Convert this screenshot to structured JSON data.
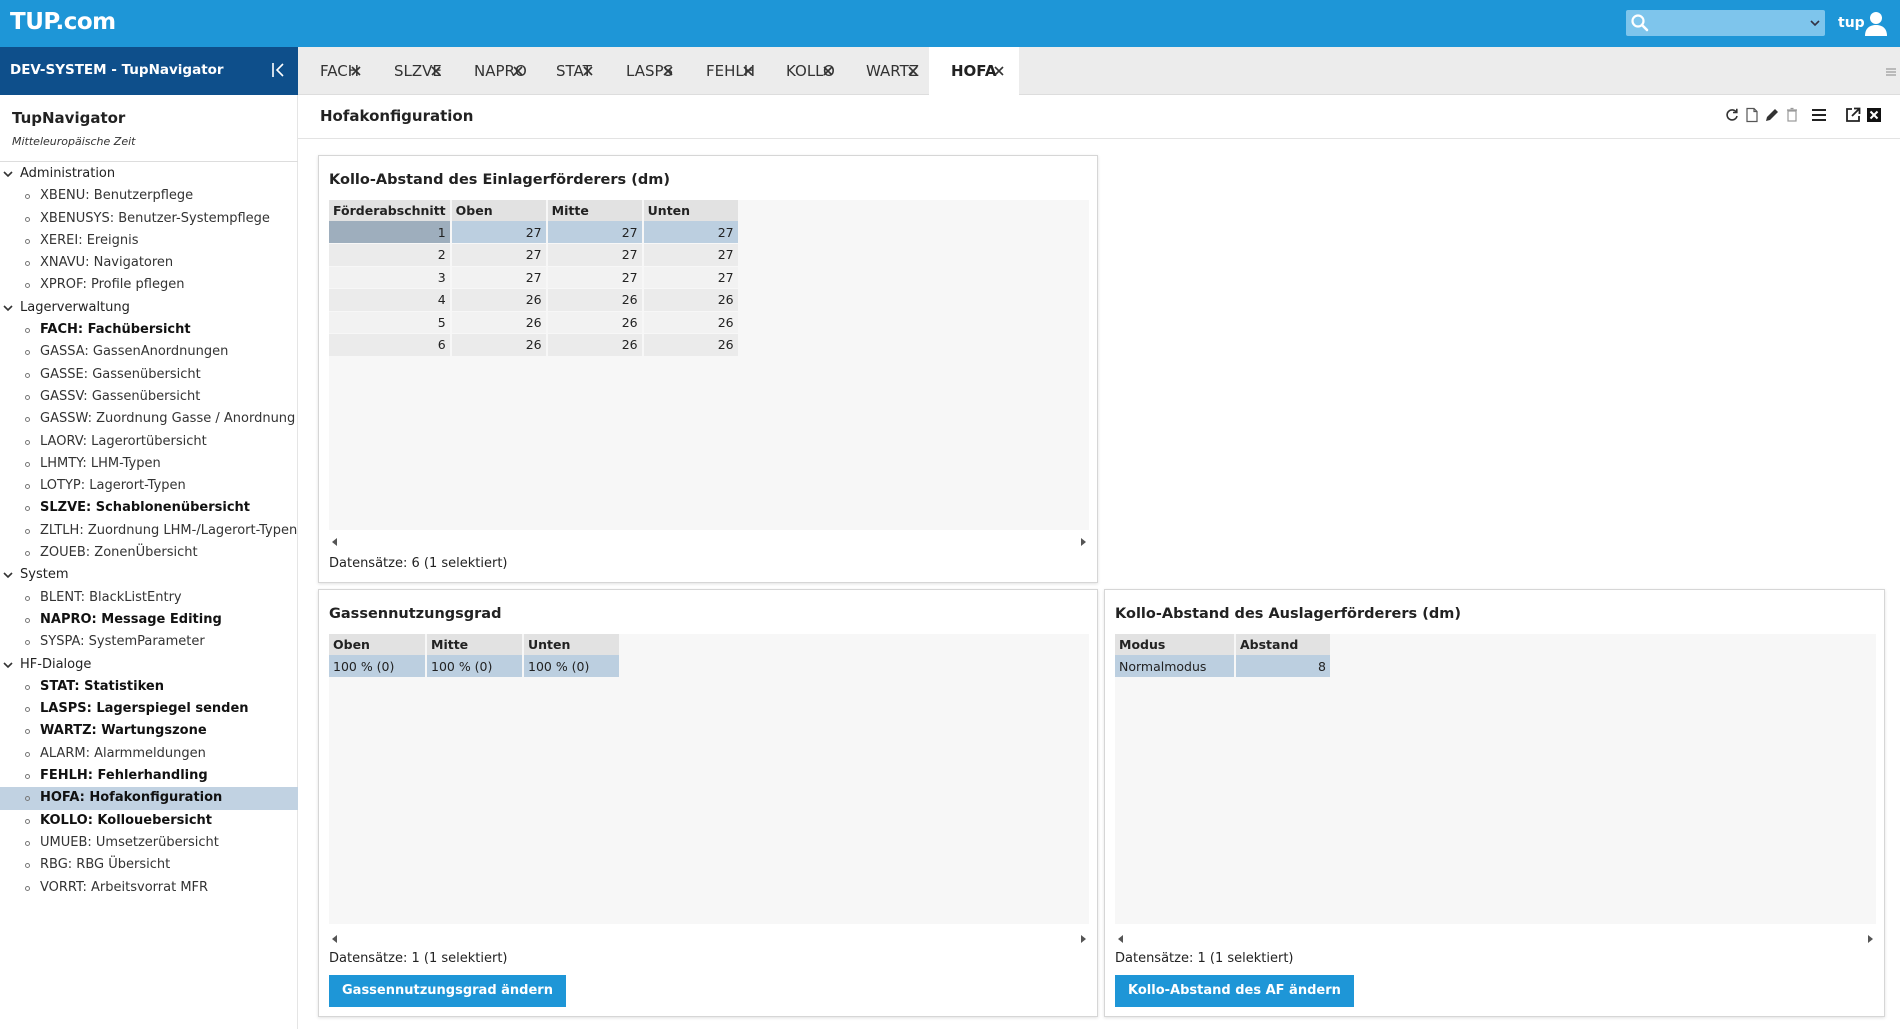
{
  "app": {
    "logo": "TUP.com",
    "user": "tup",
    "search": {
      "placeholder": ""
    }
  },
  "sidebar": {
    "system_title": "DEV-SYSTEM - TupNavigator",
    "nav_title": "TupNavigator",
    "nav_subtitle": "Mitteleuropäische Zeit",
    "groups": [
      {
        "label": "Administration",
        "items": [
          {
            "label": "XBENU: Benutzerpflege",
            "bold": false
          },
          {
            "label": "XBENUSYS: Benutzer-Systempflege",
            "bold": false
          },
          {
            "label": "XEREI: Ereignis",
            "bold": false
          },
          {
            "label": "XNAVU: Navigatoren",
            "bold": false
          },
          {
            "label": "XPROF: Profile pflegen",
            "bold": false
          }
        ]
      },
      {
        "label": "Lagerverwaltung",
        "items": [
          {
            "label": "FACH: Fachübersicht",
            "bold": true
          },
          {
            "label": "GASSA: GassenAnordnungen",
            "bold": false
          },
          {
            "label": "GASSE: Gassenübersicht",
            "bold": false
          },
          {
            "label": "GASSV: Gassenübersicht",
            "bold": false
          },
          {
            "label": "GASSW: Zuordnung Gasse / Anordnung",
            "bold": false
          },
          {
            "label": "LAORV: Lagerortübersicht",
            "bold": false
          },
          {
            "label": "LHMTY: LHM-Typen",
            "bold": false
          },
          {
            "label": "LOTYP: Lagerort-Typen",
            "bold": false
          },
          {
            "label": "SLZVE: Schablonenübersicht",
            "bold": true
          },
          {
            "label": "ZLTLH: Zuordnung LHM-/Lagerort-Typen",
            "bold": false
          },
          {
            "label": "ZOUEB: ZonenÜbersicht",
            "bold": false
          }
        ]
      },
      {
        "label": "System",
        "items": [
          {
            "label": "BLENT: BlackListEntry",
            "bold": false
          },
          {
            "label": "NAPRO: Message Editing",
            "bold": true
          },
          {
            "label": "SYSPA: SystemParameter",
            "bold": false
          }
        ]
      },
      {
        "label": "HF-Dialoge",
        "items": [
          {
            "label": "STAT: Statistiken",
            "bold": true
          },
          {
            "label": "LASPS: Lagerspiegel senden",
            "bold": true
          },
          {
            "label": "WARTZ: Wartungszone",
            "bold": true
          },
          {
            "label": "ALARM: Alarmmeldungen",
            "bold": false
          },
          {
            "label": "FEHLH: Fehlerhandling",
            "bold": true
          },
          {
            "label": "HOFA: Hofakonfiguration",
            "bold": true,
            "selected": true
          },
          {
            "label": "KOLLO: Kollouebersicht",
            "bold": true
          },
          {
            "label": "UMUEB: Umsetzerübersicht",
            "bold": false
          },
          {
            "label": "RBG: RBG Übersicht",
            "bold": false
          },
          {
            "label": "VORRT: Arbeitsvorrat MFR",
            "bold": false
          }
        ]
      }
    ]
  },
  "tabs": [
    {
      "label": "FACH"
    },
    {
      "label": "SLZVE"
    },
    {
      "label": "NAPRO"
    },
    {
      "label": "STAT"
    },
    {
      "label": "LASPS"
    },
    {
      "label": "FEHLH"
    },
    {
      "label": "KOLLO"
    },
    {
      "label": "WARTZ"
    },
    {
      "label": "HOFA",
      "active": true
    }
  ],
  "content": {
    "title": "Hofakonfiguration",
    "panel1": {
      "title": "Kollo-Abstand des Einlagerförderers (dm)",
      "columns": [
        "Förderabschnitt",
        "Oben",
        "Mitte",
        "Unten"
      ],
      "rows": [
        [
          "1",
          "27",
          "27",
          "27"
        ],
        [
          "2",
          "27",
          "27",
          "27"
        ],
        [
          "3",
          "27",
          "27",
          "27"
        ],
        [
          "4",
          "26",
          "26",
          "26"
        ],
        [
          "5",
          "26",
          "26",
          "26"
        ],
        [
          "6",
          "26",
          "26",
          "26"
        ]
      ],
      "records": "Datensätze: 6 (1 selektiert)"
    },
    "panel2": {
      "title": "Gassennutzungsgrad",
      "columns": [
        "Oben",
        "Mitte",
        "Unten"
      ],
      "rows": [
        [
          "100 % (0)",
          "100 % (0)",
          "100 % (0)"
        ]
      ],
      "records": "Datensätze: 1 (1 selektiert)",
      "button": "Gassennutzungsgrad ändern"
    },
    "panel3": {
      "title": "Kollo-Abstand des Auslagerförderers (dm)",
      "columns": [
        "Modus",
        "Abstand"
      ],
      "rows": [
        [
          "Normalmodus",
          "8"
        ]
      ],
      "records": "Datensätze: 1 (1 selektiert)",
      "button": "Kollo-Abstand des AF ändern"
    }
  },
  "colors": {
    "topbar": "#1e96d7",
    "sidebar_head": "#0e4f8b",
    "selected_row": "#bccfe0",
    "button": "#1e96d7"
  }
}
